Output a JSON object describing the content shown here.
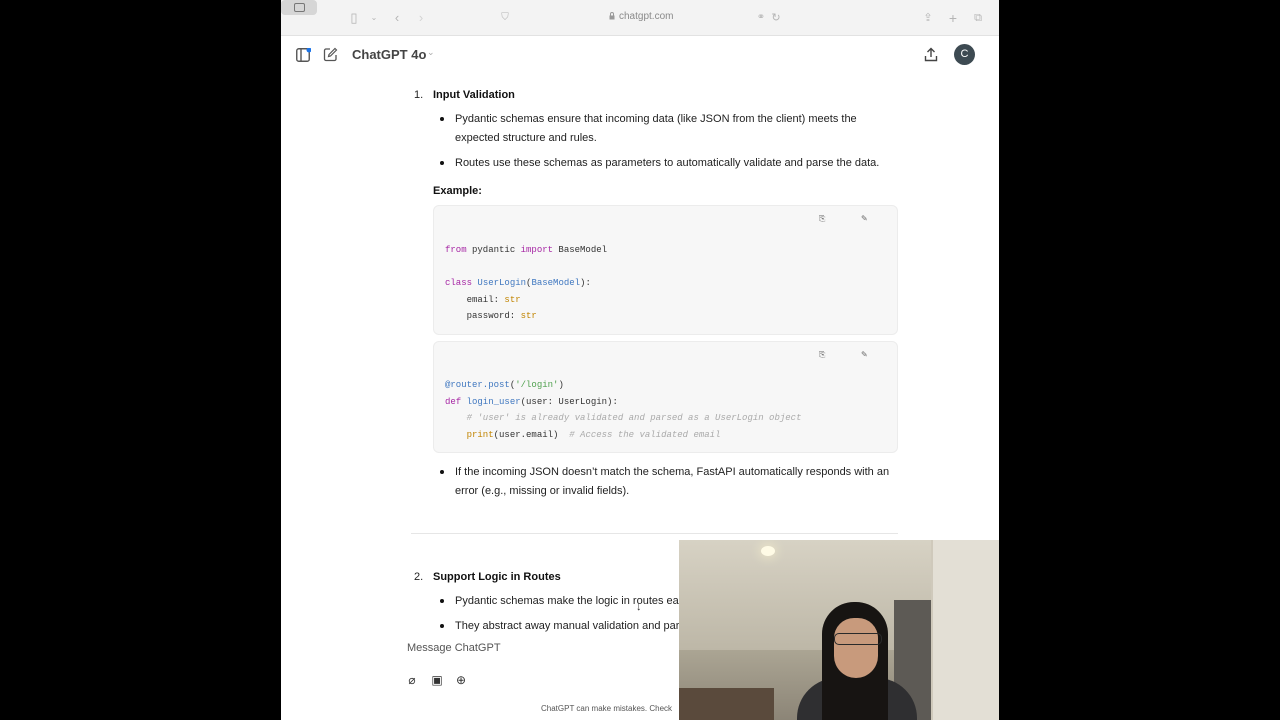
{
  "browser": {
    "url": "chatgpt.com"
  },
  "header": {
    "model": "ChatGPT 4o",
    "avatar_letter": "C"
  },
  "content": {
    "section1": {
      "number": "1.",
      "title": "Input Validation",
      "bullets": [
        "Pydantic schemas ensure that incoming data (like JSON from the client) meets the expected structure and rules.",
        "Routes use these schemas as parameters to automatically validate and parse the data."
      ],
      "example_label": "Example:"
    },
    "code1": {
      "lang": "python",
      "copy": "Copy",
      "edit": "Edit"
    },
    "code2": {
      "lang": "python",
      "copy": "Copy",
      "edit": "Edit"
    },
    "after_bullet": "If the incoming JSON doesn’t match the schema, FastAPI automatically responds with an error (e.g., missing or invalid fields).",
    "section2": {
      "number": "2.",
      "title": "Support Logic in Routes",
      "bullets": [
        "Pydantic schemas make the logic in routes ea",
        "They abstract away manual validation and par"
      ]
    }
  },
  "composer": {
    "placeholder": "Message ChatGPT"
  },
  "footer": {
    "note": "ChatGPT can make mistakes. Check"
  }
}
